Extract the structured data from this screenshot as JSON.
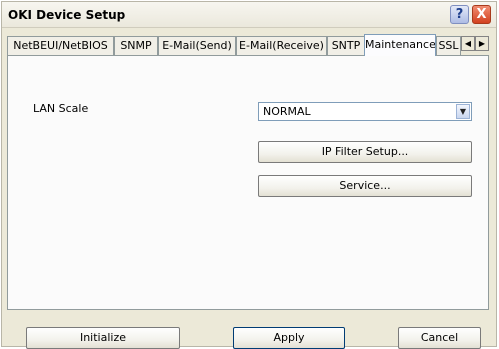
{
  "window": {
    "title": "OKI Device Setup"
  },
  "titlebar": {
    "help_label": "?",
    "close_label": "X"
  },
  "tabs": [
    {
      "label": "NetBEUI/NetBIOS",
      "active": false
    },
    {
      "label": "SNMP",
      "active": false
    },
    {
      "label": "E-Mail(Send)",
      "active": false
    },
    {
      "label": "E-Mail(Receive)",
      "active": false
    },
    {
      "label": "SNTP",
      "active": false
    },
    {
      "label": "Maintenance",
      "active": true
    },
    {
      "label": "SSL",
      "active": false
    }
  ],
  "tab_scroll": {
    "left_icon": "◀",
    "right_icon": "▶"
  },
  "maintenance": {
    "lan_scale_label": "LAN Scale",
    "lan_scale_value": "NORMAL",
    "lan_scale_arrow": "▼",
    "ip_filter_button": "IP Filter Setup...",
    "service_button": "Service..."
  },
  "footer": {
    "initialize": "Initialize",
    "apply": "Apply",
    "cancel": "Cancel"
  },
  "colors": {
    "dialog_bg": "#ece9d8",
    "panel_bg": "#fbfbfb",
    "close_button": "#d2411f"
  }
}
